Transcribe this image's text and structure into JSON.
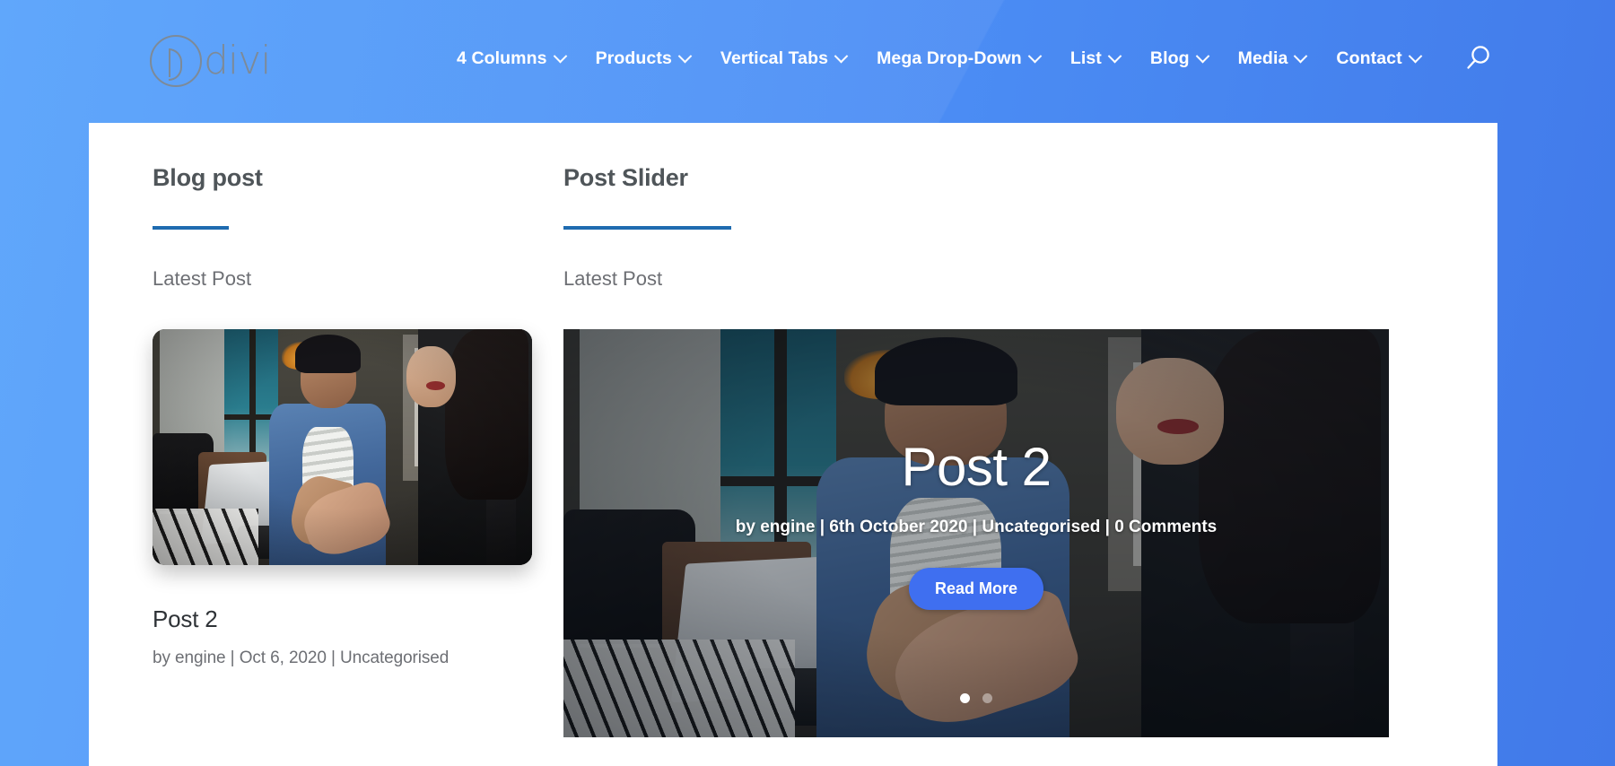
{
  "header": {
    "logo": {
      "text": "divi",
      "mark": "divi-circle-d-logo"
    },
    "nav": [
      {
        "label": "4 Columns",
        "has_dropdown": true
      },
      {
        "label": "Products",
        "has_dropdown": true
      },
      {
        "label": "Vertical Tabs",
        "has_dropdown": true
      },
      {
        "label": "Mega Drop-Down",
        "has_dropdown": true
      },
      {
        "label": "List",
        "has_dropdown": true
      },
      {
        "label": "Blog",
        "has_dropdown": true
      },
      {
        "label": "Media",
        "has_dropdown": true
      },
      {
        "label": "Contact",
        "has_dropdown": true
      }
    ],
    "search_icon": "search-icon"
  },
  "left_column": {
    "title": "Blog post",
    "section_label": "Latest Post",
    "post": {
      "title": "Post 2",
      "meta": "by engine | Oct 6, 2020 | Uncategorised",
      "image_alt": "two-women-working-on-laptop"
    }
  },
  "right_column": {
    "title": "Post Slider",
    "section_label": "Latest Post",
    "slide": {
      "title": "Post 2",
      "meta": "by engine | 6th October 2020 | Uncategorised | 0 Comments",
      "button": "Read More",
      "image_alt": "two-women-working-on-laptop"
    },
    "pagination": {
      "total": 2,
      "active_index": 0
    }
  },
  "colors": {
    "header_blue": "#4e92f7",
    "page_blue_light": "#57a2fb",
    "page_blue_dark": "#4179e9",
    "accent_rule": "#1f6bb0",
    "button_blue": "#3f6ff0",
    "heading_gray": "#4f5559",
    "body_gray": "#6d6f74",
    "card_white": "#ffffff"
  }
}
